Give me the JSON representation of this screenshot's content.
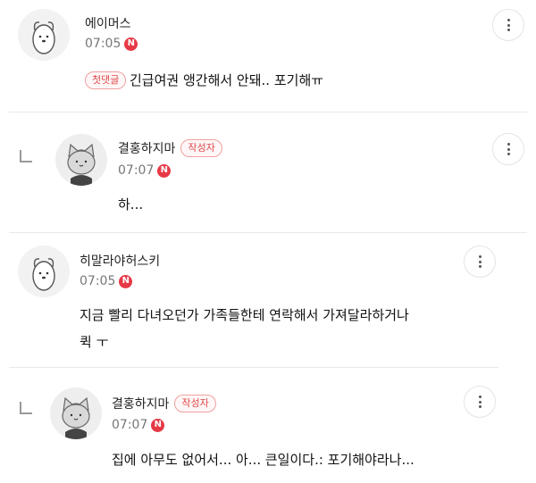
{
  "comments": [
    {
      "nickname": "에이머스",
      "time": "07:05",
      "new_badge": "N",
      "first_comment_tag": "첫댓글",
      "text": "긴급여권 앵간해서 안돼.. 포기해ㅠ"
    },
    {
      "nickname": "결홍하지마",
      "author_tag": "작성자",
      "time": "07:07",
      "new_badge": "N",
      "text": "하..."
    },
    {
      "nickname": "히말라야허스키",
      "time": "07:05",
      "new_badge": "N",
      "text_line1": "지금 빨리 다녀오던가 가족들한테 연락해서 가져달라하거나",
      "text_line2": "퀵 ㅜ"
    },
    {
      "nickname": "결홍하지마",
      "author_tag": "작성자",
      "time": "07:07",
      "new_badge": "N",
      "text": "집에 아무도 없어서... 아... 큰일이다.: 포기해야라나..."
    }
  ],
  "colors": {
    "badge_red": "#e63946",
    "tag_red": "#e04848",
    "divider": "#e8e8e8"
  },
  "icons": {
    "more": "vertical-ellipsis-icon",
    "reply": "reply-arrow-icon",
    "avatar_1": "dog-character-avatar",
    "avatar_2": "cat-character-avatar"
  }
}
